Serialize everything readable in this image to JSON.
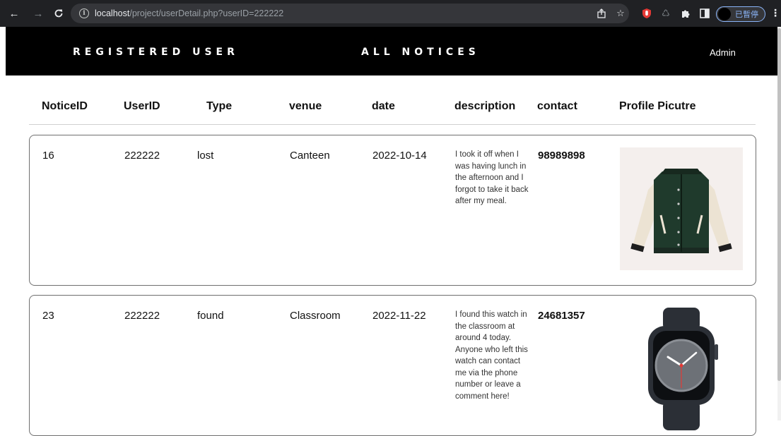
{
  "browser": {
    "url_host": "localhost",
    "url_path": "/project/userDetail.php?userID=222222",
    "profile_label": "已暫停"
  },
  "header": {
    "nav": [
      "REGISTERED USER",
      "ALL NOTICES"
    ],
    "admin": "Admin"
  },
  "table": {
    "columns": [
      "NoticeID",
      "UserID",
      "Type",
      "venue",
      "date",
      "description",
      "contact",
      "Profile Picutre"
    ],
    "rows": [
      {
        "notice_id": "16",
        "user_id": "222222",
        "type": "lost",
        "venue": "Canteen",
        "date": "2022-10-14",
        "description": "I took it off when I was having lunch in the afternoon and I forgot to take it back after my meal.",
        "contact": "98989898",
        "picture": "green-varsity-jacket"
      },
      {
        "notice_id": "23",
        "user_id": "222222",
        "type": "found",
        "venue": "Classroom",
        "date": "2022-11-22",
        "description": "I found this watch in the classroom at around 4 today. Anyone who left this watch can contact me via the phone number or leave a comment here!",
        "contact": "24681357",
        "picture": "smart-watch"
      }
    ]
  },
  "colors": {
    "header_bg": "#000000",
    "chrome_bg": "#202124",
    "card_border": "#6f6f6f",
    "jacket_body": "#1f3a2c",
    "jacket_sleeve": "#ece3d3",
    "watch_case": "#2b2f36"
  }
}
